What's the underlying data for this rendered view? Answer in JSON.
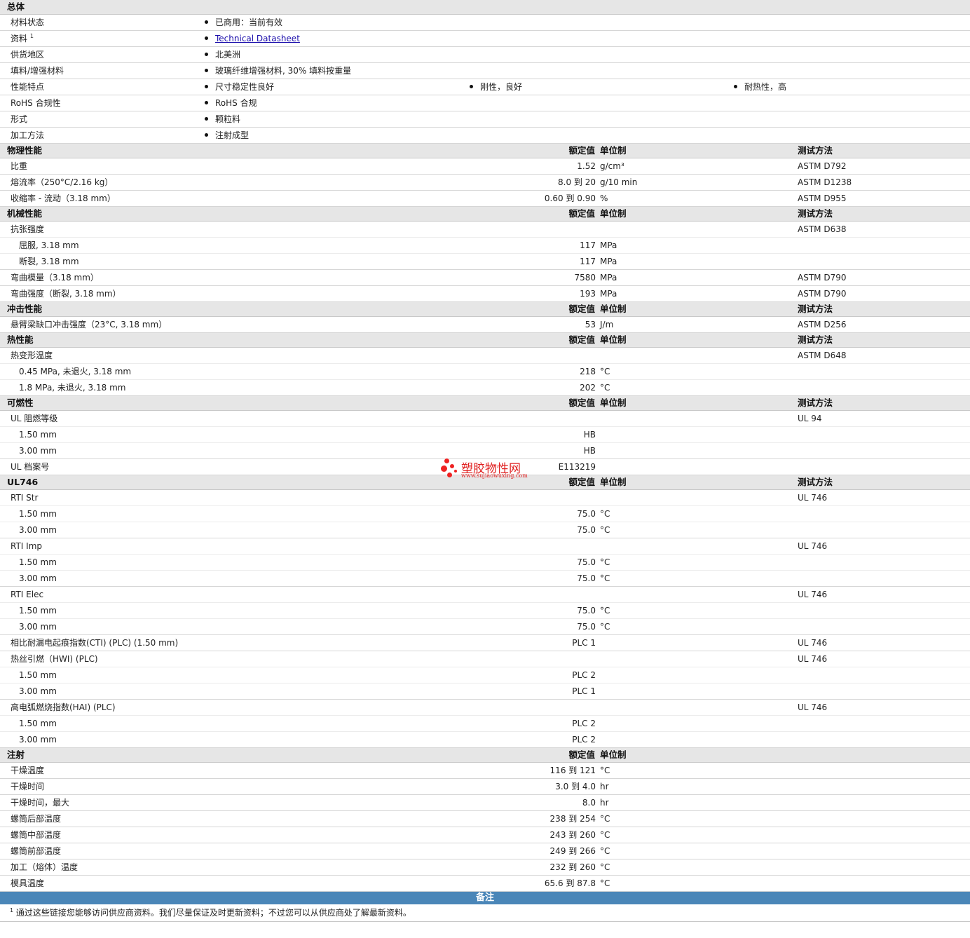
{
  "headers": {
    "value": "额定值",
    "unit": "单位制",
    "test": "测试方法"
  },
  "general": {
    "title": "总体",
    "rows": [
      {
        "name": "材料状态",
        "items": [
          "已商用：当前有效"
        ]
      },
      {
        "name": "资料",
        "sup": "1",
        "items": [
          "Technical Datasheet"
        ],
        "link": true
      },
      {
        "name": "供货地区",
        "items": [
          "北美洲"
        ]
      },
      {
        "name": "填料/增强材料",
        "items": [
          "玻璃纤维增强材料, 30% 填料按重量"
        ]
      },
      {
        "name": "性能特点",
        "items": [
          "尺寸稳定性良好",
          "刚性，良好",
          "耐热性，高"
        ]
      },
      {
        "name": "RoHS 合规性",
        "items": [
          "RoHS 合规"
        ]
      },
      {
        "name": "形式",
        "items": [
          "颗粒料"
        ]
      },
      {
        "name": "加工方法",
        "items": [
          "注射成型"
        ]
      }
    ]
  },
  "sections": [
    {
      "title": "物理性能",
      "rows": [
        {
          "name": "比重",
          "value": "1.52",
          "unit": "g/cm³",
          "test": "ASTM D792"
        },
        {
          "name": "熔流率（250°C/2.16 kg）",
          "value": "8.0 到  20",
          "unit": "g/10 min",
          "test": "ASTM D1238"
        },
        {
          "name": "收缩率 - 流动（3.18 mm）",
          "value": "0.60 到  0.90",
          "unit": "%",
          "test": "ASTM D955"
        }
      ]
    },
    {
      "title": "机械性能",
      "rows": [
        {
          "name": "抗张强度",
          "value": "",
          "unit": "",
          "test": "ASTM D638",
          "group": true
        },
        {
          "name": "屈服, 3.18 mm",
          "value": "117",
          "unit": "MPa",
          "test": "",
          "sub": true,
          "cont": true
        },
        {
          "name": "断裂, 3.18 mm",
          "value": "117",
          "unit": "MPa",
          "test": "",
          "sub": true
        },
        {
          "name": "弯曲模量（3.18 mm）",
          "value": "7580",
          "unit": "MPa",
          "test": "ASTM D790"
        },
        {
          "name": "弯曲强度（断裂, 3.18 mm）",
          "value": "193",
          "unit": "MPa",
          "test": "ASTM D790"
        }
      ]
    },
    {
      "title": "冲击性能",
      "rows": [
        {
          "name": "悬臂梁缺口冲击强度（23°C, 3.18 mm）",
          "value": "53",
          "unit": "J/m",
          "test": "ASTM D256"
        }
      ]
    },
    {
      "title": "热性能",
      "rows": [
        {
          "name": "热变形温度",
          "value": "",
          "unit": "",
          "test": "ASTM D648",
          "group": true
        },
        {
          "name": "0.45 MPa, 未退火, 3.18 mm",
          "value": "218",
          "unit": "°C",
          "test": "",
          "sub": true,
          "cont": true
        },
        {
          "name": "1.8 MPa, 未退火, 3.18 mm",
          "value": "202",
          "unit": "°C",
          "test": "",
          "sub": true
        }
      ]
    },
    {
      "title": "可燃性",
      "rows": [
        {
          "name": "UL 阻燃等级",
          "value": "",
          "unit": "",
          "test": "UL 94",
          "group": true
        },
        {
          "name": "1.50 mm",
          "value": "HB",
          "unit": "",
          "test": "",
          "sub": true,
          "cont": true
        },
        {
          "name": "3.00 mm",
          "value": "HB",
          "unit": "",
          "test": "",
          "sub": true
        },
        {
          "name": "UL 档案号",
          "value": "E113219",
          "unit": "",
          "test": ""
        }
      ]
    },
    {
      "title": "UL746",
      "rows": [
        {
          "name": "RTI Str",
          "value": "",
          "unit": "",
          "test": "UL 746",
          "group": true
        },
        {
          "name": "1.50 mm",
          "value": "75.0",
          "unit": "°C",
          "test": "",
          "sub": true,
          "cont": true
        },
        {
          "name": "3.00 mm",
          "value": "75.0",
          "unit": "°C",
          "test": "",
          "sub": true
        },
        {
          "name": "RTI Imp",
          "value": "",
          "unit": "",
          "test": "UL 746",
          "group": true
        },
        {
          "name": "1.50 mm",
          "value": "75.0",
          "unit": "°C",
          "test": "",
          "sub": true,
          "cont": true
        },
        {
          "name": "3.00 mm",
          "value": "75.0",
          "unit": "°C",
          "test": "",
          "sub": true
        },
        {
          "name": "RTI Elec",
          "value": "",
          "unit": "",
          "test": "UL 746",
          "group": true
        },
        {
          "name": "1.50 mm",
          "value": "75.0",
          "unit": "°C",
          "test": "",
          "sub": true,
          "cont": true
        },
        {
          "name": "3.00 mm",
          "value": "75.0",
          "unit": "°C",
          "test": "",
          "sub": true
        },
        {
          "name": "相比耐漏电起痕指数(CTI) (PLC) (1.50 mm)",
          "value": "PLC 1",
          "unit": "",
          "test": "UL 746"
        },
        {
          "name": "热丝引燃（HWI) (PLC)",
          "value": "",
          "unit": "",
          "test": "UL 746",
          "group": true
        },
        {
          "name": "1.50 mm",
          "value": "PLC 2",
          "unit": "",
          "test": "",
          "sub": true,
          "cont": true
        },
        {
          "name": "3.00 mm",
          "value": "PLC 1",
          "unit": "",
          "test": "",
          "sub": true
        },
        {
          "name": "高电弧燃烧指数(HAI) (PLC)",
          "value": "",
          "unit": "",
          "test": "UL 746",
          "group": true
        },
        {
          "name": "1.50 mm",
          "value": "PLC 2",
          "unit": "",
          "test": "",
          "sub": true,
          "cont": true
        },
        {
          "name": "3.00 mm",
          "value": "PLC 2",
          "unit": "",
          "test": "",
          "sub": true
        }
      ]
    },
    {
      "title": "注射",
      "notest": true,
      "rows": [
        {
          "name": "干燥温度",
          "value": "116 到  121",
          "unit": "°C",
          "test": ""
        },
        {
          "name": "干燥时间",
          "value": "3.0 到  4.0",
          "unit": "hr",
          "test": ""
        },
        {
          "name": "干燥时间，最大",
          "value": "8.0",
          "unit": "hr",
          "test": ""
        },
        {
          "name": "螺筒后部温度",
          "value": "238 到  254",
          "unit": "°C",
          "test": ""
        },
        {
          "name": "螺筒中部温度",
          "value": "243 到  260",
          "unit": "°C",
          "test": ""
        },
        {
          "name": "螺筒前部温度",
          "value": "249 到  266",
          "unit": "°C",
          "test": ""
        },
        {
          "name": "加工（熔体）温度",
          "value": "232 到  260",
          "unit": "°C",
          "test": ""
        },
        {
          "name": "模具温度",
          "value": "65.6 到  87.8",
          "unit": "°C",
          "test": ""
        }
      ]
    }
  ],
  "notes": {
    "title": "备注",
    "footnote_mark": "1",
    "footnote": "通过这些链接您能够访问供应商资料。我们尽量保证及时更新资料；不过您可以从供应商处了解最新资料。"
  },
  "watermark": {
    "text": "塑胶物性网",
    "url": "www.sujiaowuxing.com",
    "color": "#e02020"
  }
}
